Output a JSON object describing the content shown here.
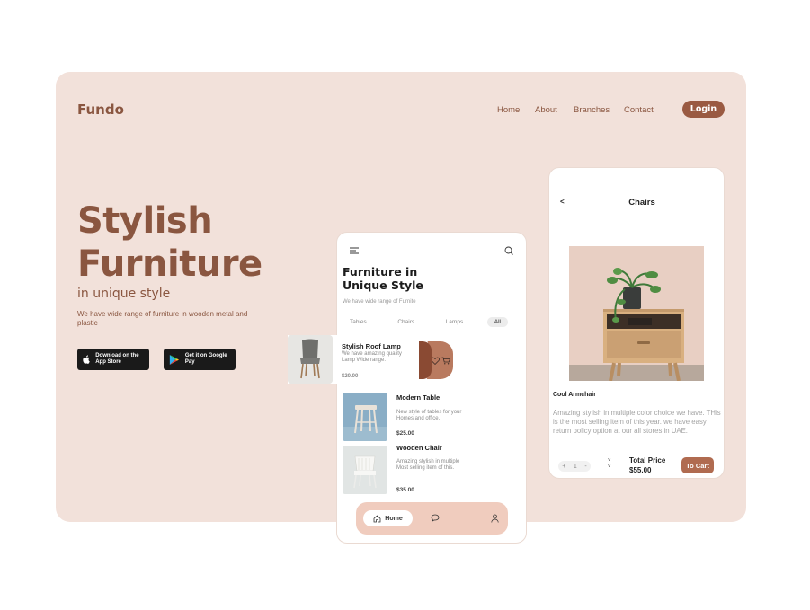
{
  "brand": "Fundo",
  "nav": {
    "items": [
      "Home",
      "About",
      "Branches",
      "Contact"
    ],
    "login": "Login"
  },
  "hero": {
    "title_line1": "Stylish",
    "title_line2": "Furniture",
    "subtitle": "in unique style",
    "description": "We have wide range of furniture in wooden metal and plastic",
    "app_store": "Download on the App Store",
    "google_play": "Get it on Google Pay"
  },
  "phone1": {
    "title": "Furniture in Unique Style",
    "subtitle": "We have wide range of Furnite",
    "tabs": [
      "Tables",
      "Chairs",
      "Lamps",
      "All"
    ],
    "active_tab": "All",
    "featured": {
      "name": "Stylish Roof Lamp",
      "desc": "We have amazing quality Lamp Wide range.",
      "price": "$20.00"
    },
    "items": [
      {
        "name": "Modern Table",
        "desc": "New style of tables for your Homes and office.",
        "price": "$25.00"
      },
      {
        "name": "Wooden Chair",
        "desc": "Amazing stylish in multiple Most selling item of this.",
        "price": "$35.00"
      }
    ],
    "bottom_nav": {
      "home": "Home"
    }
  },
  "phone2": {
    "back": "<",
    "title": "Chairs",
    "product_name": "Cool Armchair",
    "product_desc": "Amazing stylish in multiple color choice we have. THis is the most selling item of this year. we have easy return policy option at our all stores in UAE.",
    "qty_minus": "+",
    "qty": "1",
    "qty_plus": "-",
    "total_label": "Total Price",
    "total_price": "$55.00",
    "cart_button": "To Cart"
  },
  "colors": {
    "brand_brown": "#8a5640",
    "card_bg": "#f2e1da",
    "button": "#9a5a42",
    "accent": "#b06b50"
  }
}
